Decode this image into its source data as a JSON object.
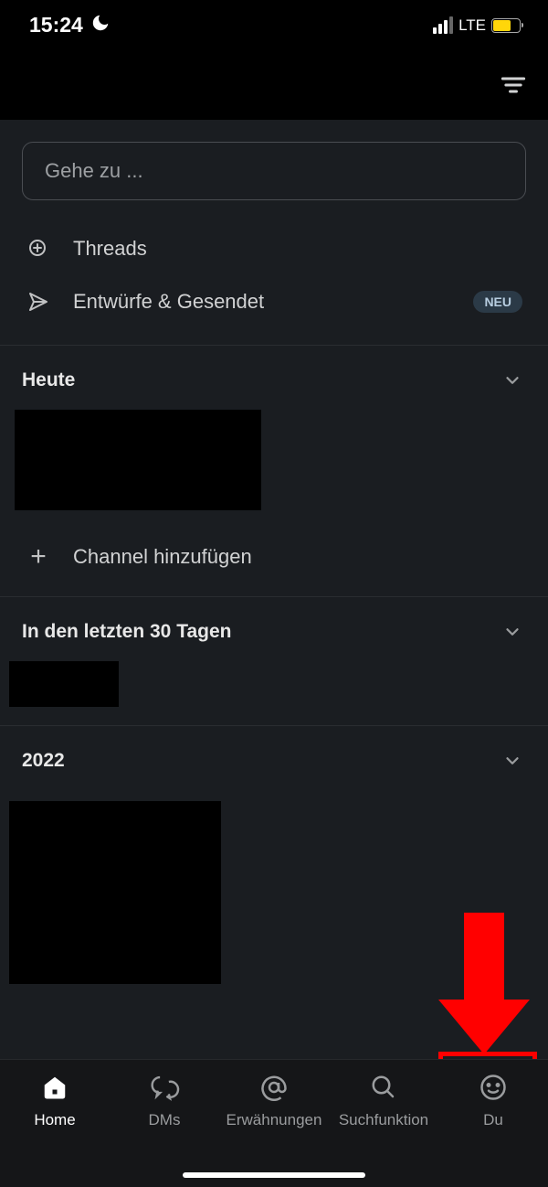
{
  "status": {
    "time": "15:24",
    "network": "LTE"
  },
  "search": {
    "placeholder": "Gehe zu ..."
  },
  "nav": {
    "threads": "Threads",
    "drafts": "Entwürfe & Gesendet",
    "badge_new": "NEU"
  },
  "sections": {
    "today": "Heute",
    "add_channel": "Channel hinzufügen",
    "last30": "In den letzten 30 Tagen",
    "year": "2022"
  },
  "tabs": {
    "home": "Home",
    "dms": "DMs",
    "mentions": "Erwähnungen",
    "search": "Suchfunktion",
    "you": "Du"
  }
}
